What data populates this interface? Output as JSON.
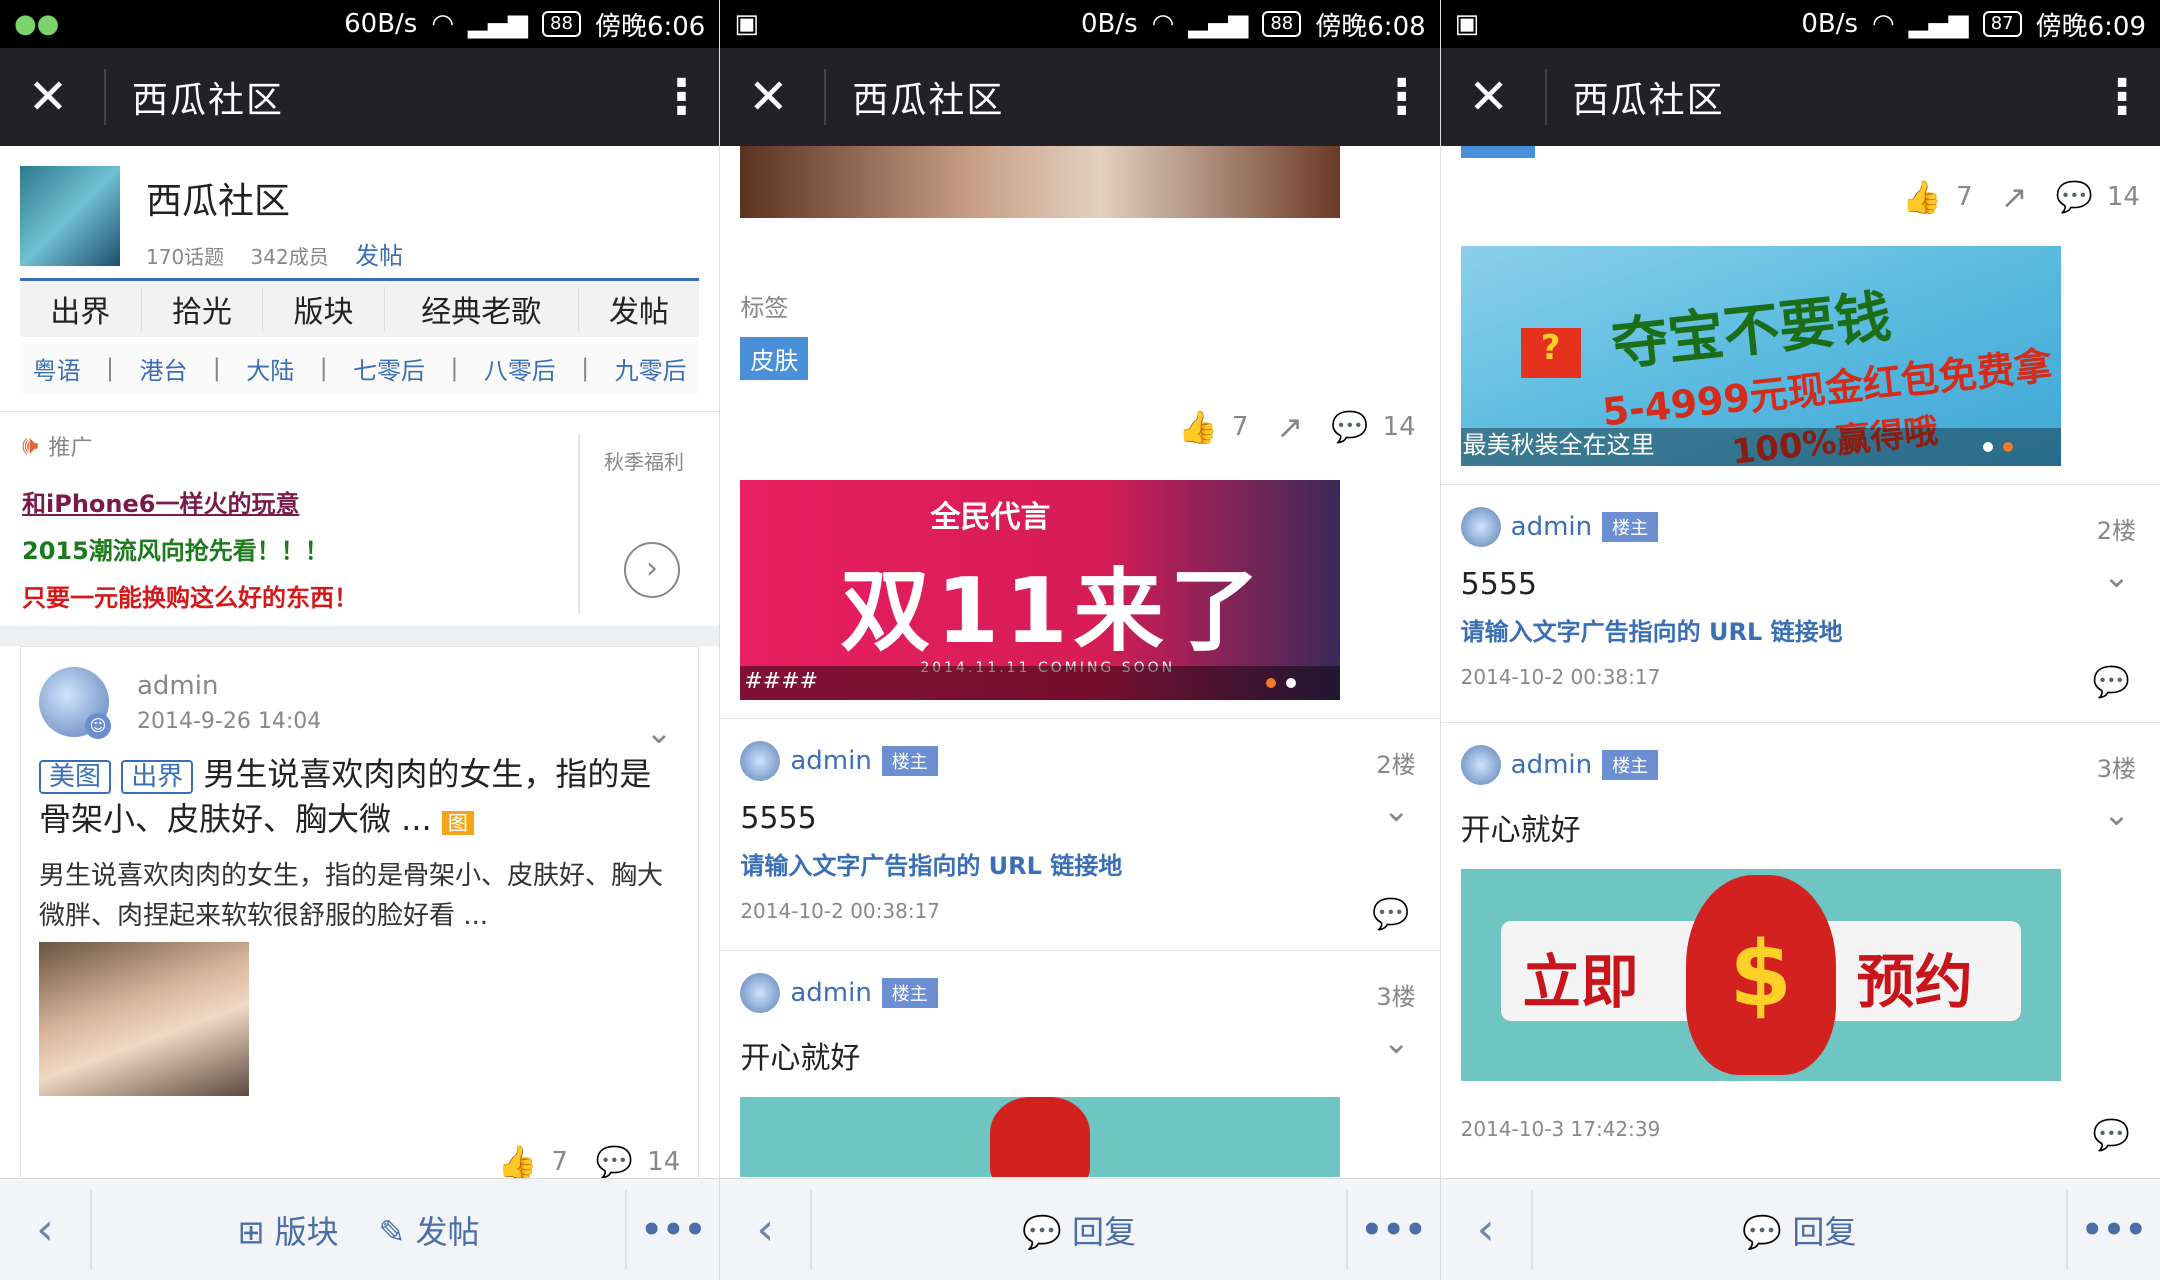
{
  "screens": [
    {
      "status": {
        "speed": "60B/s",
        "battery": "88",
        "time": "傍晚6:06"
      },
      "title": "西瓜社区",
      "community": {
        "name": "西瓜社区",
        "topics": "170话题",
        "members": "342成员",
        "post": "发帖"
      },
      "tabs": [
        "出界",
        "拾光",
        "版块",
        "经典老歌",
        "发帖"
      ],
      "subtabs": [
        "粤语",
        "港台",
        "大陆",
        "七零后",
        "八零后",
        "九零后"
      ],
      "promo": {
        "label": "推广",
        "side": "秋季福利",
        "line1": "和iPhone6一样火的玩意",
        "line2": "2015潮流风向抢先看！！！",
        "line3": "只要一元能换购这么好的东西！"
      },
      "post": {
        "author": "admin",
        "date": "2014-9-26 14:04",
        "tag1": "美图",
        "tag2": "出界",
        "title": "男生说喜欢肉肉的女生，指的是骨架小、皮肤好、胸大微 ...",
        "img_tag": "图",
        "excerpt": "男生说喜欢肉肉的女生，指的是骨架小、皮肤好、胸大微胖、肉捏起来软软很舒服的脸好看 ...",
        "likes": "7",
        "comments": "14"
      },
      "bottom": {
        "left": "版块",
        "right": "发帖"
      }
    },
    {
      "status": {
        "speed": "0B/s",
        "battery": "88",
        "time": "傍晚6:08"
      },
      "title": "西瓜社区",
      "tags_label": "标签",
      "tag": "皮肤",
      "likes": "7",
      "comments": "14",
      "banner": {
        "top": "全民代言",
        "main": "双11来了",
        "sub": "2014.11.11   COMING SOON",
        "caption": "####"
      },
      "replies": [
        {
          "author": "admin",
          "badge": "楼主",
          "floor": "2楼",
          "text": "5555",
          "link": "请输入文字广告指向的 URL 链接地",
          "date": "2014-10-2 00:38:17"
        },
        {
          "author": "admin",
          "badge": "楼主",
          "floor": "3楼",
          "text": "开心就好"
        }
      ],
      "bottom": {
        "reply": "回复"
      }
    },
    {
      "status": {
        "speed": "0B/s",
        "battery": "87",
        "time": "傍晚6:09"
      },
      "title": "西瓜社区",
      "likes": "7",
      "comments": "14",
      "banner": {
        "main": "夺宝不要钱",
        "sub": "5-4999元现金红包免费拿",
        "pct": "100%赢得哦",
        "caption": "最美秋装全在这里"
      },
      "replies": [
        {
          "author": "admin",
          "badge": "楼主",
          "floor": "2楼",
          "text": "5555",
          "link": "请输入文字广告指向的 URL 链接地",
          "date": "2014-10-2 00:38:17"
        },
        {
          "author": "admin",
          "badge": "楼主",
          "floor": "3楼",
          "text": "开心就好",
          "btn_left": "立即",
          "btn_right": "预约",
          "date": "2014-10-3 17:42:39"
        }
      ],
      "bottom": {
        "reply": "回复"
      }
    }
  ]
}
